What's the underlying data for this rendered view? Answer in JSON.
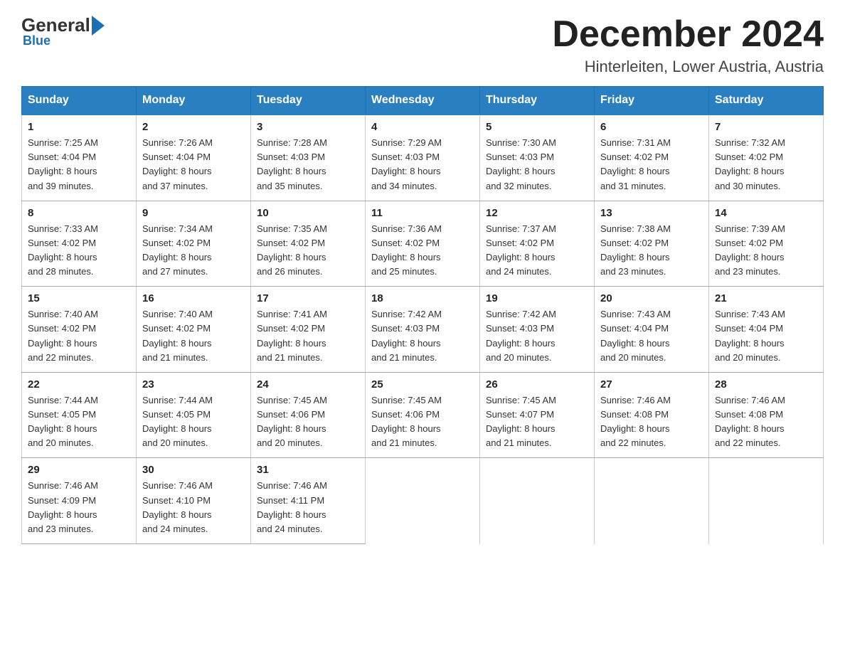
{
  "logo": {
    "general": "General",
    "arrow": "▶",
    "blue": "Blue",
    "sub": "Blue"
  },
  "header": {
    "month_year": "December 2024",
    "location": "Hinterleiten, Lower Austria, Austria"
  },
  "weekdays": [
    "Sunday",
    "Monday",
    "Tuesday",
    "Wednesday",
    "Thursday",
    "Friday",
    "Saturday"
  ],
  "weeks": [
    [
      {
        "day": "1",
        "sunrise": "7:25 AM",
        "sunset": "4:04 PM",
        "daylight": "8 hours and 39 minutes."
      },
      {
        "day": "2",
        "sunrise": "7:26 AM",
        "sunset": "4:04 PM",
        "daylight": "8 hours and 37 minutes."
      },
      {
        "day": "3",
        "sunrise": "7:28 AM",
        "sunset": "4:03 PM",
        "daylight": "8 hours and 35 minutes."
      },
      {
        "day": "4",
        "sunrise": "7:29 AM",
        "sunset": "4:03 PM",
        "daylight": "8 hours and 34 minutes."
      },
      {
        "day": "5",
        "sunrise": "7:30 AM",
        "sunset": "4:03 PM",
        "daylight": "8 hours and 32 minutes."
      },
      {
        "day": "6",
        "sunrise": "7:31 AM",
        "sunset": "4:02 PM",
        "daylight": "8 hours and 31 minutes."
      },
      {
        "day": "7",
        "sunrise": "7:32 AM",
        "sunset": "4:02 PM",
        "daylight": "8 hours and 30 minutes."
      }
    ],
    [
      {
        "day": "8",
        "sunrise": "7:33 AM",
        "sunset": "4:02 PM",
        "daylight": "8 hours and 28 minutes."
      },
      {
        "day": "9",
        "sunrise": "7:34 AM",
        "sunset": "4:02 PM",
        "daylight": "8 hours and 27 minutes."
      },
      {
        "day": "10",
        "sunrise": "7:35 AM",
        "sunset": "4:02 PM",
        "daylight": "8 hours and 26 minutes."
      },
      {
        "day": "11",
        "sunrise": "7:36 AM",
        "sunset": "4:02 PM",
        "daylight": "8 hours and 25 minutes."
      },
      {
        "day": "12",
        "sunrise": "7:37 AM",
        "sunset": "4:02 PM",
        "daylight": "8 hours and 24 minutes."
      },
      {
        "day": "13",
        "sunrise": "7:38 AM",
        "sunset": "4:02 PM",
        "daylight": "8 hours and 23 minutes."
      },
      {
        "day": "14",
        "sunrise": "7:39 AM",
        "sunset": "4:02 PM",
        "daylight": "8 hours and 23 minutes."
      }
    ],
    [
      {
        "day": "15",
        "sunrise": "7:40 AM",
        "sunset": "4:02 PM",
        "daylight": "8 hours and 22 minutes."
      },
      {
        "day": "16",
        "sunrise": "7:40 AM",
        "sunset": "4:02 PM",
        "daylight": "8 hours and 21 minutes."
      },
      {
        "day": "17",
        "sunrise": "7:41 AM",
        "sunset": "4:02 PM",
        "daylight": "8 hours and 21 minutes."
      },
      {
        "day": "18",
        "sunrise": "7:42 AM",
        "sunset": "4:03 PM",
        "daylight": "8 hours and 21 minutes."
      },
      {
        "day": "19",
        "sunrise": "7:42 AM",
        "sunset": "4:03 PM",
        "daylight": "8 hours and 20 minutes."
      },
      {
        "day": "20",
        "sunrise": "7:43 AM",
        "sunset": "4:04 PM",
        "daylight": "8 hours and 20 minutes."
      },
      {
        "day": "21",
        "sunrise": "7:43 AM",
        "sunset": "4:04 PM",
        "daylight": "8 hours and 20 minutes."
      }
    ],
    [
      {
        "day": "22",
        "sunrise": "7:44 AM",
        "sunset": "4:05 PM",
        "daylight": "8 hours and 20 minutes."
      },
      {
        "day": "23",
        "sunrise": "7:44 AM",
        "sunset": "4:05 PM",
        "daylight": "8 hours and 20 minutes."
      },
      {
        "day": "24",
        "sunrise": "7:45 AM",
        "sunset": "4:06 PM",
        "daylight": "8 hours and 20 minutes."
      },
      {
        "day": "25",
        "sunrise": "7:45 AM",
        "sunset": "4:06 PM",
        "daylight": "8 hours and 21 minutes."
      },
      {
        "day": "26",
        "sunrise": "7:45 AM",
        "sunset": "4:07 PM",
        "daylight": "8 hours and 21 minutes."
      },
      {
        "day": "27",
        "sunrise": "7:46 AM",
        "sunset": "4:08 PM",
        "daylight": "8 hours and 22 minutes."
      },
      {
        "day": "28",
        "sunrise": "7:46 AM",
        "sunset": "4:08 PM",
        "daylight": "8 hours and 22 minutes."
      }
    ],
    [
      {
        "day": "29",
        "sunrise": "7:46 AM",
        "sunset": "4:09 PM",
        "daylight": "8 hours and 23 minutes."
      },
      {
        "day": "30",
        "sunrise": "7:46 AM",
        "sunset": "4:10 PM",
        "daylight": "8 hours and 24 minutes."
      },
      {
        "day": "31",
        "sunrise": "7:46 AM",
        "sunset": "4:11 PM",
        "daylight": "8 hours and 24 minutes."
      },
      null,
      null,
      null,
      null
    ]
  ]
}
